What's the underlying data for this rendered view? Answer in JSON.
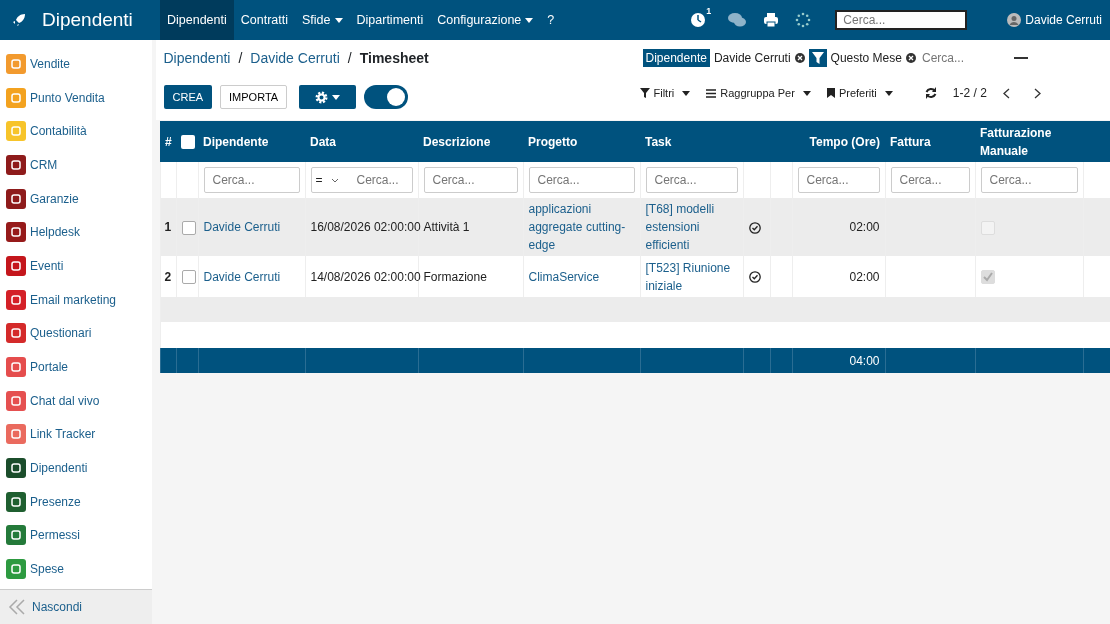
{
  "navbar": {
    "app_title": "Dipendenti",
    "menu": [
      {
        "label": "Dipendenti",
        "selected": true,
        "dropdown": false
      },
      {
        "label": "Contratti",
        "selected": false,
        "dropdown": false
      },
      {
        "label": "Sfide",
        "selected": false,
        "dropdown": true
      },
      {
        "label": "Dipartimenti",
        "selected": false,
        "dropdown": false
      },
      {
        "label": "Configurazione",
        "selected": false,
        "dropdown": true
      },
      {
        "label": "?",
        "selected": false,
        "dropdown": false
      }
    ],
    "activity_count": "1",
    "search": {
      "placeholder": "Cerca..."
    },
    "user": "Davide Cerruti"
  },
  "sidebar": {
    "items": [
      {
        "label": "Vendite",
        "color": "#f29a2e"
      },
      {
        "label": "Punto Vendita",
        "color": "#f3a21f"
      },
      {
        "label": "Contabilità",
        "color": "#f7c42a"
      },
      {
        "label": "CRM",
        "color": "#8e1b1b"
      },
      {
        "label": "Garanzie",
        "color": "#8e1b1b"
      },
      {
        "label": "Helpdesk",
        "color": "#961a1a"
      },
      {
        "label": "Eventi",
        "color": "#c4161c"
      },
      {
        "label": "Email marketing",
        "color": "#d42027"
      },
      {
        "label": "Questionari",
        "color": "#d42a2a"
      },
      {
        "label": "Portale",
        "color": "#e54d4d"
      },
      {
        "label": "Chat dal vivo",
        "color": "#e55050"
      },
      {
        "label": "Link Tracker",
        "color": "#ea6a5e"
      },
      {
        "label": "Dipendenti",
        "color": "#1b4d2b"
      },
      {
        "label": "Presenze",
        "color": "#1f5f30"
      },
      {
        "label": "Permessi",
        "color": "#247a3a"
      },
      {
        "label": "Spese",
        "color": "#2d9a40"
      }
    ],
    "hide_label": "Nascondi"
  },
  "breadcrumb": [
    {
      "label": "Dipendenti",
      "separator": "/"
    },
    {
      "label": "Davide Cerruti",
      "separator": "/"
    },
    {
      "label": "Timesheet"
    }
  ],
  "buttons": {
    "create": "CREA",
    "import": "IMPORTA"
  },
  "toggle": {
    "on": true
  },
  "search_facets": [
    {
      "kind": "field",
      "field": "Dipendente",
      "value": "Davide Cerruti"
    },
    {
      "kind": "filter",
      "value": "Questo Mese"
    }
  ],
  "search_placeholder": "Cerca...",
  "filters": [
    "Filtri",
    "Raggruppa Per",
    "Preferiti"
  ],
  "pager": "1-2 / 2",
  "table": {
    "number_heading": "#",
    "select_all": {
      "checked": false
    },
    "columns": [
      "Dipendente",
      "Data",
      "Descrizione",
      "Progetto",
      "Task",
      "Tempo (Ore)",
      "Fattura",
      "Fatturazione Manuale"
    ],
    "filter_placeholders": [
      "Cerca...",
      "Cerca...",
      "Cerca...",
      "Cerca...",
      "Cerca...",
      "Cerca...",
      "Cerca...",
      "Cerca..."
    ],
    "date_operator": "=",
    "rows": [
      {
        "number": "1",
        "checked": false,
        "employee": "Davide Cerruti",
        "date": "16/08/2026 02:00:00",
        "description": "Attività 1",
        "project": "applicazioni aggregate cutting-edge",
        "task": "[T68] modelli estensioni efficienti",
        "hours": "02:00",
        "manual_billing": false
      },
      {
        "number": "2",
        "checked": false,
        "employee": "Davide Cerruti",
        "date": "14/08/2026 02:00:00",
        "description": "Formazione",
        "project": "ClimaService",
        "task": "[T523] Riunione iniziale",
        "hours": "02:00",
        "manual_billing": true
      }
    ],
    "total_hours": "04:00"
  }
}
